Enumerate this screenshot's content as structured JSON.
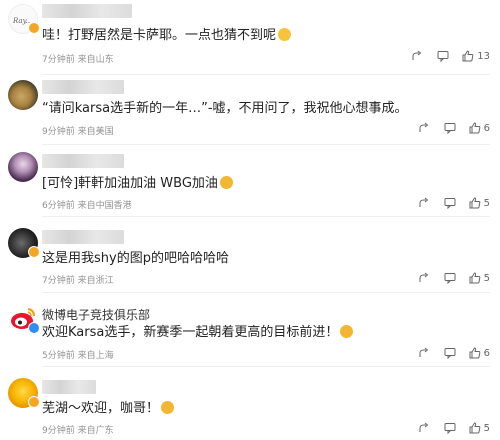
{
  "comments": [
    {
      "username": "",
      "text": "哇！打野居然是卡萨耶。一点也猜不到呢",
      "time": "7分钟前",
      "location": "来自山东",
      "likes": "13",
      "emoji": "heart-eyes-emoji"
    },
    {
      "username": "",
      "text": "“请问karsa选手新的一年…”-嘘，不用问了，我祝他心想事成。",
      "time": "9分钟前",
      "location": "来自美国",
      "likes": "6"
    },
    {
      "username": "",
      "text": "[可怜]軒軒加油加油 WBG加油",
      "time": "6分钟前",
      "location": "来自中国香港",
      "likes": "5",
      "emoji": "cheer-emoji"
    },
    {
      "username": "",
      "text": "这是用我shy的图p的吧哈哈哈哈",
      "time": "7分钟前",
      "location": "来自浙江",
      "likes": "5"
    },
    {
      "username": "微博电子竞技俱乐部",
      "text": "欢迎Karsa选手，新赛季一起朝着更高的目标前进！",
      "time": "5分钟前",
      "location": "来自上海",
      "likes": "6",
      "emoji": "cheer-emoji"
    },
    {
      "username": "",
      "text": "芜湖～欢迎，咖哥！",
      "time": "9分钟前",
      "location": "来自广东",
      "likes": "5",
      "emoji": "cheer-emoji"
    }
  ],
  "icons": {
    "share": "share-icon",
    "reply": "comment-icon",
    "like": "thumbs-up-icon",
    "verified": "verified-v-icon"
  },
  "colors": {
    "verified_gold": "#f5a623",
    "verified_blue": "#2f8ff0",
    "meta_gray": "#939393"
  }
}
